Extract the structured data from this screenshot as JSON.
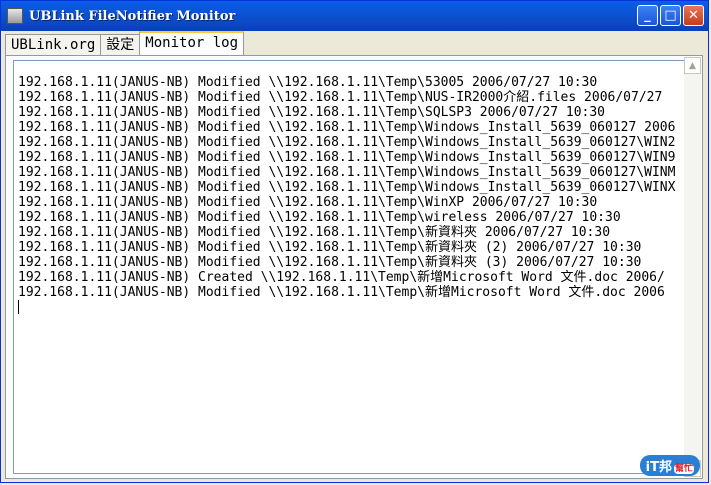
{
  "window": {
    "title": "UBLink FileNotifier Monitor",
    "controls": {
      "minimize": "_",
      "maximize": "□",
      "close": "✕"
    }
  },
  "tabs": [
    {
      "label": "UBLink.org"
    },
    {
      "label": "設定"
    },
    {
      "label": "Monitor log",
      "active": true
    }
  ],
  "log": {
    "lines": [
      "192.168.1.11(JANUS-NB) Modified \\\\192.168.1.11\\Temp\\53005 2006/07/27 10:30",
      "192.168.1.11(JANUS-NB) Modified \\\\192.168.1.11\\Temp\\NUS-IR2000介紹.files 2006/07/27",
      "192.168.1.11(JANUS-NB) Modified \\\\192.168.1.11\\Temp\\SQLSP3 2006/07/27 10:30",
      "192.168.1.11(JANUS-NB) Modified \\\\192.168.1.11\\Temp\\Windows_Install_5639_060127 2006",
      "192.168.1.11(JANUS-NB) Modified \\\\192.168.1.11\\Temp\\Windows_Install_5639_060127\\WIN2",
      "192.168.1.11(JANUS-NB) Modified \\\\192.168.1.11\\Temp\\Windows_Install_5639_060127\\WIN9",
      "192.168.1.11(JANUS-NB) Modified \\\\192.168.1.11\\Temp\\Windows_Install_5639_060127\\WINM",
      "192.168.1.11(JANUS-NB) Modified \\\\192.168.1.11\\Temp\\Windows_Install_5639_060127\\WINX",
      "192.168.1.11(JANUS-NB) Modified \\\\192.168.1.11\\Temp\\WinXP 2006/07/27 10:30",
      "192.168.1.11(JANUS-NB) Modified \\\\192.168.1.11\\Temp\\wireless 2006/07/27 10:30",
      "192.168.1.11(JANUS-NB) Modified \\\\192.168.1.11\\Temp\\新資料夾 2006/07/27 10:30",
      "192.168.1.11(JANUS-NB) Modified \\\\192.168.1.11\\Temp\\新資料夾 (2) 2006/07/27 10:30",
      "192.168.1.11(JANUS-NB) Modified \\\\192.168.1.11\\Temp\\新資料夾 (3) 2006/07/27 10:30",
      "192.168.1.11(JANUS-NB) Created \\\\192.168.1.11\\Temp\\新增Microsoft Word 文件.doc 2006/",
      "192.168.1.11(JANUS-NB) Modified \\\\192.168.1.11\\Temp\\新增Microsoft Word 文件.doc 2006"
    ]
  },
  "scrollbar": {
    "up": "▲",
    "down": "▼"
  },
  "watermark": {
    "main": "iT邦",
    "sub": "幫忙"
  }
}
